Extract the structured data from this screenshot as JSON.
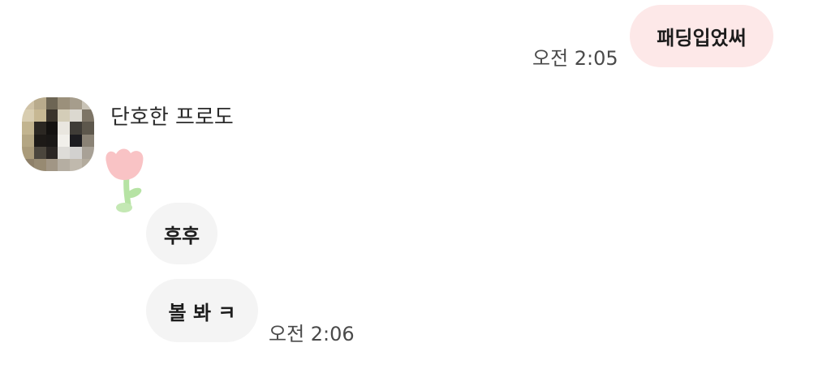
{
  "messages": {
    "outgoing": {
      "text": "패딩입었써",
      "time": "오전 2:05"
    },
    "incoming": {
      "sender": "단호한 프로도",
      "bubble_1": "후후",
      "bubble_2": "볼 봐 ㅋ",
      "time": "오전 2:06"
    }
  },
  "colors": {
    "outgoing_bubble": "#fde8e8",
    "incoming_bubble": "#f4f4f4",
    "background": "#ffffff"
  },
  "icons": {
    "avatar": "pixelated-profile-avatar",
    "sticker": "pink-tulip-sticker"
  }
}
